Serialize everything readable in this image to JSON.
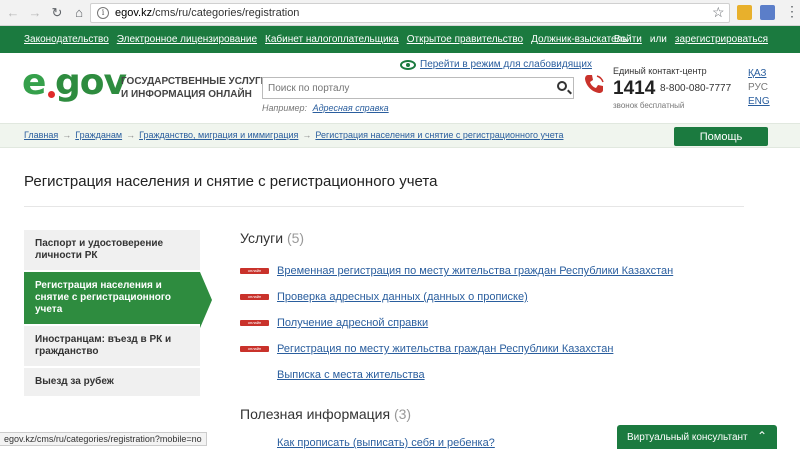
{
  "browser": {
    "url_host": "egov.kz",
    "url_path": "/cms/ru/categories/registration",
    "status_url": "egov.kz/cms/ru/categories/registration?mobile=no"
  },
  "topnav": {
    "items": [
      "Законодательство",
      "Электронное лицензирование",
      "Кабинет налогоплательщика",
      "Открытое правительство",
      "Должник-взыскатель"
    ],
    "login": "Войти",
    "or": "или",
    "register": "зарегистрироваться"
  },
  "header": {
    "logo_e": "e",
    "logo_gov": "gov",
    "tagline": "Государственные услуги и информация онлайн",
    "accessibility_link": "Перейти в режим для слабовидящих",
    "search_placeholder": "Поиск по порталу",
    "example_prefix": "Например:",
    "example_link": "Адресная справка",
    "contact_title": "Единый контакт-центр",
    "contact_short": "1414",
    "contact_phone": "8-800-080-7777",
    "contact_free": "звонок бесплатный",
    "langs": [
      "ҚАЗ",
      "РУС",
      "ENG"
    ]
  },
  "breadcrumb": {
    "items": [
      "Главная",
      "Гражданам",
      "Гражданство, миграция и иммиграция",
      "Регистрация населения и снятие с регистрационного учета"
    ],
    "help_button": "Помощь"
  },
  "page_title": "Регистрация населения и снятие с регистрационного учета",
  "categories": [
    {
      "label": "Паспорт и удостоверение личности РК",
      "active": false
    },
    {
      "label": "Регистрация населения и снятие с регистрационного учета",
      "active": true
    },
    {
      "label": "Иностранцам: въезд в РК и гражданство",
      "active": false
    },
    {
      "label": "Выезд за рубеж",
      "active": false
    }
  ],
  "services": {
    "title": "Услуги",
    "count": "(5)",
    "badge": "онлайн",
    "items": [
      {
        "label": "Временная регистрация по месту жительства граждан Республики Казахстан",
        "online": true
      },
      {
        "label": "Проверка адресных данных (данных о прописке)",
        "online": true
      },
      {
        "label": "Получение адресной справки",
        "online": true
      },
      {
        "label": "Регистрация по месту жительства граждан Республики Казахстан",
        "online": true
      },
      {
        "label": "Выписка с места жительства",
        "online": false
      }
    ]
  },
  "useful": {
    "title": "Полезная информация",
    "count": "(3)",
    "first_link": "Как прописать (выписать) себя и ребенка?"
  },
  "consultant": {
    "label": "Виртуальный консультант"
  },
  "colors": {
    "brand_green": "#1b7a3f",
    "accent_green": "#2e8c3f",
    "online_badge": "#c9322b",
    "link_blue": "#2a5e9e"
  }
}
